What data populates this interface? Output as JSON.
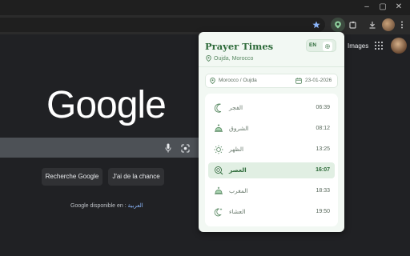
{
  "browser": {
    "window_controls": [
      "–",
      "▢",
      "✕"
    ]
  },
  "google": {
    "logo": "Google",
    "search_button": "Recherche Google",
    "lucky_button": "J'ai de la chance",
    "language_offer": "Google disponible en : ",
    "language_link": "العربية",
    "images_link": "Images"
  },
  "popup": {
    "title": "Prayer Times",
    "location": "Oujda, Morocco",
    "lang_toggle": "EN",
    "city_selector": "Morocco / Oujda",
    "date": "23-01-2026",
    "prayers": [
      {
        "name": "الفجر",
        "time": "06:39",
        "icon": "crescent-moon-icon",
        "active": false
      },
      {
        "name": "الشروق",
        "time": "08:12",
        "icon": "sunrise-icon",
        "active": false
      },
      {
        "name": "الظهر",
        "time": "13:25",
        "icon": "sun-icon",
        "active": false
      },
      {
        "name": "العصر",
        "time": "16:07",
        "icon": "sun-search-icon",
        "active": true
      },
      {
        "name": "المغرب",
        "time": "18:33",
        "icon": "sunset-icon",
        "active": false
      },
      {
        "name": "العشاء",
        "time": "19:50",
        "icon": "moon-stars-icon",
        "active": false
      }
    ]
  },
  "colors": {
    "accent": "#2e6b3a",
    "popup_bg": "#f2f8f3",
    "active_row": "#e1efe3"
  }
}
